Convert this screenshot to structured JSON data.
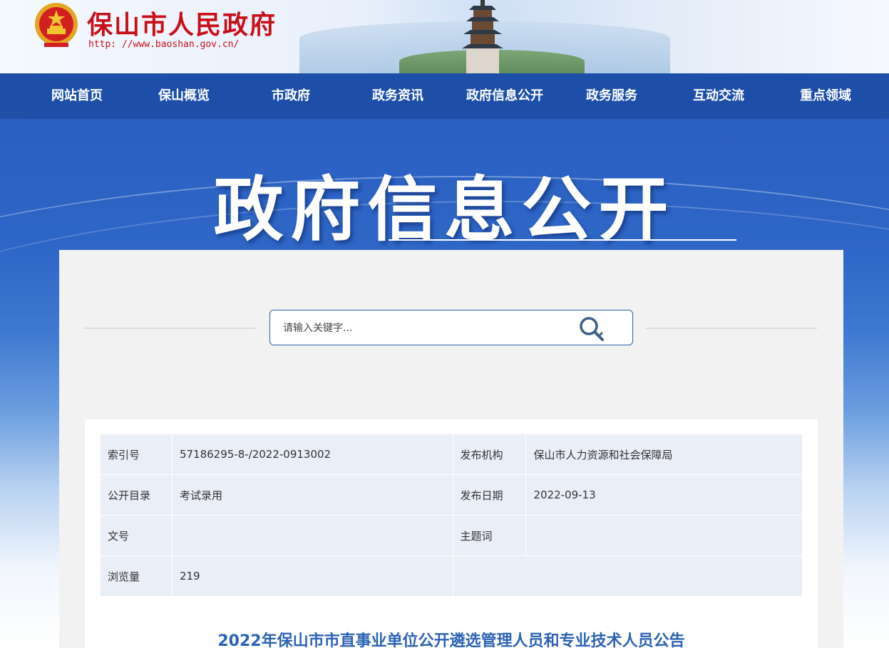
{
  "header": {
    "site_title": "保山市人民政府",
    "site_url": "http: //www.baoshan.gov.cn/"
  },
  "nav": {
    "items": [
      {
        "label": "网站首页"
      },
      {
        "label": "保山概览"
      },
      {
        "label": "市政府"
      },
      {
        "label": "政务资讯"
      },
      {
        "label": "政府信息公开"
      },
      {
        "label": "政务服务"
      },
      {
        "label": "互动交流"
      },
      {
        "label": "重点领域"
      }
    ]
  },
  "banner": {
    "title": "政府信息公开"
  },
  "search": {
    "placeholder": "请输入关键字...",
    "icon": "magnifier-key-icon"
  },
  "meta": {
    "rows": [
      {
        "label1": "索引号",
        "value1": "57186295-8-/2022-0913002",
        "label2": "发布机构",
        "value2": "保山市人力资源和社会保障局"
      },
      {
        "label1": "公开目录",
        "value1": "考试录用",
        "label2": "发布日期",
        "value2": "2022-09-13"
      },
      {
        "label1": "文号",
        "value1": "",
        "label2": "主题词",
        "value2": ""
      },
      {
        "label1": "浏览量",
        "value1": "219",
        "label2": "",
        "value2": ""
      }
    ]
  },
  "article": {
    "title": "2022年保山市市直事业单位公开遴选管理人员和专业技术人员公告"
  },
  "colors": {
    "brand_red": "#c8101a",
    "nav_blue": "#1d4fa9",
    "title_blue": "#2d63b5"
  }
}
